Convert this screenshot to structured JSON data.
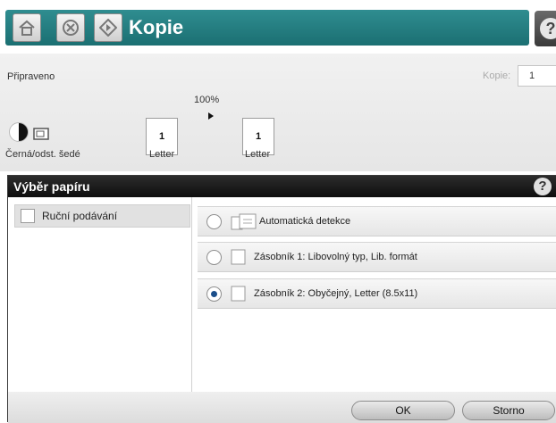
{
  "topbar": {
    "title": "Kopie",
    "home_icon": "home-icon",
    "stop_icon": "stop-icon",
    "start_icon": "start-icon",
    "help_icon": "help-icon"
  },
  "status": {
    "ready_text": "Připraveno",
    "copies_label": "Kopie:",
    "copies_value": "1",
    "scale": "100%",
    "source_page_number": "1",
    "source_page_label": "Letter",
    "target_page_number": "1",
    "target_page_label": "Letter",
    "color_mode": "Černá/odst. šedé"
  },
  "dialog": {
    "title": "Výběr papíru",
    "manual_feed_label": "Ruční podávání",
    "options": [
      {
        "label": "Automatická detekce",
        "selected": false
      },
      {
        "label": "Zásobník 1: Libovolný typ, Lib. formát",
        "selected": false
      },
      {
        "label": "Zásobník 2: Obyčejný, Letter (8.5x11)",
        "selected": true
      }
    ],
    "ok_label": "OK",
    "cancel_label": "Storno"
  },
  "colors": {
    "accent_bar": "#1f7a7d",
    "dialog_header": "#1a1a1a",
    "radio_selected": "#1a4e8a"
  }
}
